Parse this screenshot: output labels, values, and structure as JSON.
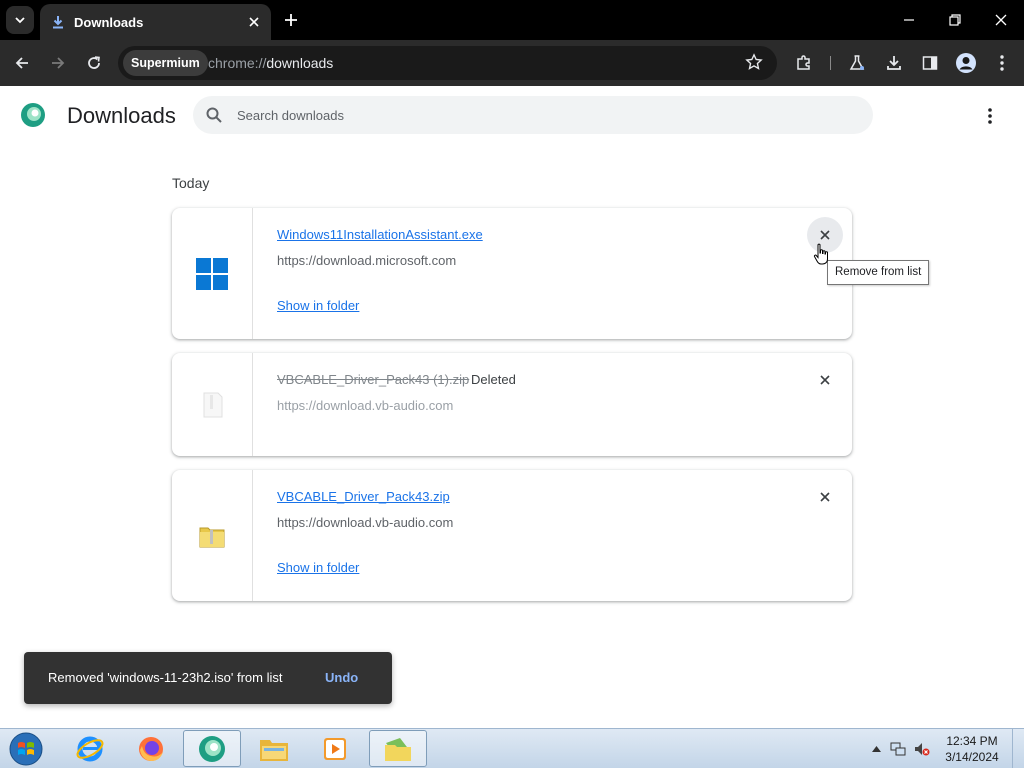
{
  "browser": {
    "tab_title": "Downloads",
    "site_chip": "Supermium",
    "url_scheme": "chrome://",
    "url_path": "downloads"
  },
  "header": {
    "title": "Downloads",
    "search_placeholder": "Search downloads"
  },
  "section_label": "Today",
  "downloads": [
    {
      "filename": "Windows11InstallationAssistant.exe",
      "url": "https://download.microsoft.com",
      "action": "Show in folder",
      "icon": "windows-logo-icon",
      "status": ""
    },
    {
      "filename": "VBCABLE_Driver_Pack43 (1).zip",
      "url": "https://download.vb-audio.com",
      "status": "Deleted",
      "icon": "zip-file-icon"
    },
    {
      "filename": "VBCABLE_Driver_Pack43.zip",
      "url": "https://download.vb-audio.com",
      "action": "Show in folder",
      "icon": "zip-folder-icon",
      "status": ""
    }
  ],
  "tooltip": "Remove from list",
  "toast": {
    "message": "Removed 'windows-11-23h2.iso' from list",
    "undo": "Undo"
  },
  "taskbar": {
    "apps": [
      "internet-explorer-icon",
      "firefox-icon",
      "supermium-icon",
      "file-explorer-icon",
      "media-player-icon",
      "zip-folder-icon"
    ],
    "time": "12:34 PM",
    "date": "3/14/2024"
  },
  "colors": {
    "accent": "#1a73e8",
    "toolbar": "#2b2b2b",
    "tabstrip": "#000000",
    "toast": "#323232"
  }
}
